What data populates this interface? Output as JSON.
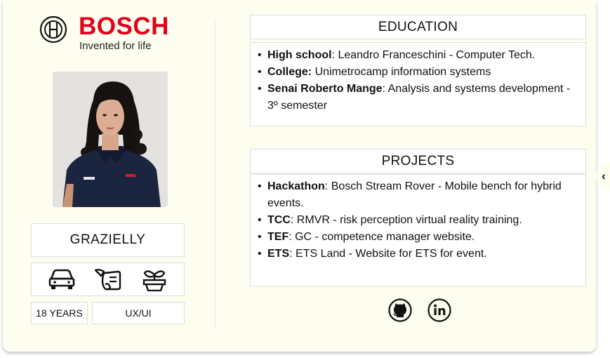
{
  "brand": {
    "name": "BOSCH",
    "tagline": "Invented for life",
    "color": "#e2001a"
  },
  "profile": {
    "name": "GRAZIELLY",
    "age": "18 YEARS",
    "role": "UX/UI",
    "hobby_icons": [
      "car-icon",
      "scroll-quill-icon",
      "potted-plant-icon"
    ]
  },
  "education": {
    "title": "EDUCATION",
    "items": [
      {
        "label": "High school",
        "text": ": Leandro Franceschini - Computer Tech."
      },
      {
        "label": "College:",
        "text": " Unimetrocamp information systems"
      },
      {
        "label": "Senai Roberto Mange",
        "text": ": Analysis and systems development - 3º semester"
      }
    ]
  },
  "projects": {
    "title": "PROJECTS",
    "items": [
      {
        "label": "Hackathon",
        "text": ": Bosch Stream Rover - Mobile bench for hybrid events."
      },
      {
        "label": "TCC",
        "text": ": RMVR - risk perception virtual reality training."
      },
      {
        "label": "TEF",
        "text": ":  GC - competence manager website."
      },
      {
        "label": "ETS",
        "text": ": ETS Land - Website for ETS for event."
      }
    ]
  },
  "social": [
    "github-icon",
    "linkedin-icon"
  ],
  "collapse_glyph": "‹"
}
